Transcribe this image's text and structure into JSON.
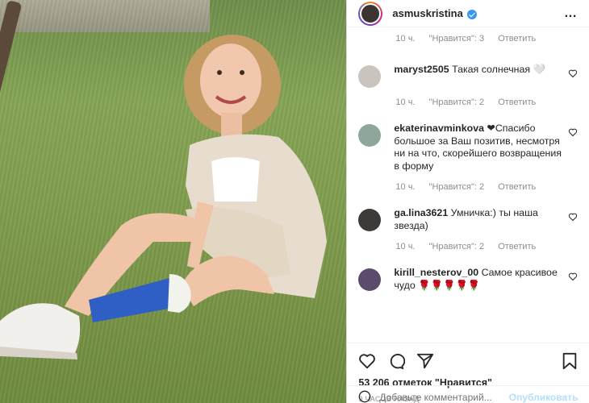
{
  "post": {
    "username": "asmuskristina",
    "more_icon": "…",
    "first_meta": {
      "time": "10 ч.",
      "likes": "\"Нравится\": 3",
      "reply": "Ответить"
    },
    "comments": [
      {
        "user": "maryst2505",
        "text": "Такая солнечная 🤍",
        "time": "10 ч.",
        "likes": "\"Нравится\": 2",
        "reply": "Ответить",
        "avatar_color": "#c9c4bd"
      },
      {
        "user": "ekaterinavminkova",
        "text": "❤Спасибо большое за Ваш позитив, несмотря ни на что, скорейшего возвращения в форму",
        "time": "10 ч.",
        "likes": "\"Нравится\": 2",
        "reply": "Ответить",
        "avatar_color": "#8fa79a"
      },
      {
        "user": "ga.lina3621",
        "text": "Умничка:) ты наша звезда)",
        "time": "10 ч.",
        "likes": "\"Нравится\": 2",
        "reply": "Ответить",
        "avatar_color": "#3d3a38"
      },
      {
        "user": "kirill_nesterov_00",
        "text": "Самое красивое чудо 🌹🌹🌹🌹🌹",
        "time": "",
        "likes": "",
        "reply": "",
        "avatar_color": "#5b4b6d"
      }
    ],
    "likes_text": "53 206 отметок \"Нравится\"",
    "time_ago": "9 ЧАСОВ НАЗАД",
    "add_comment_placeholder": "Добавьте комментарий...",
    "publish_label": "Опубликовать"
  },
  "colors": {
    "accent": "#3897f0",
    "publish": "#b2dffc",
    "meta": "#8e8e8e"
  }
}
